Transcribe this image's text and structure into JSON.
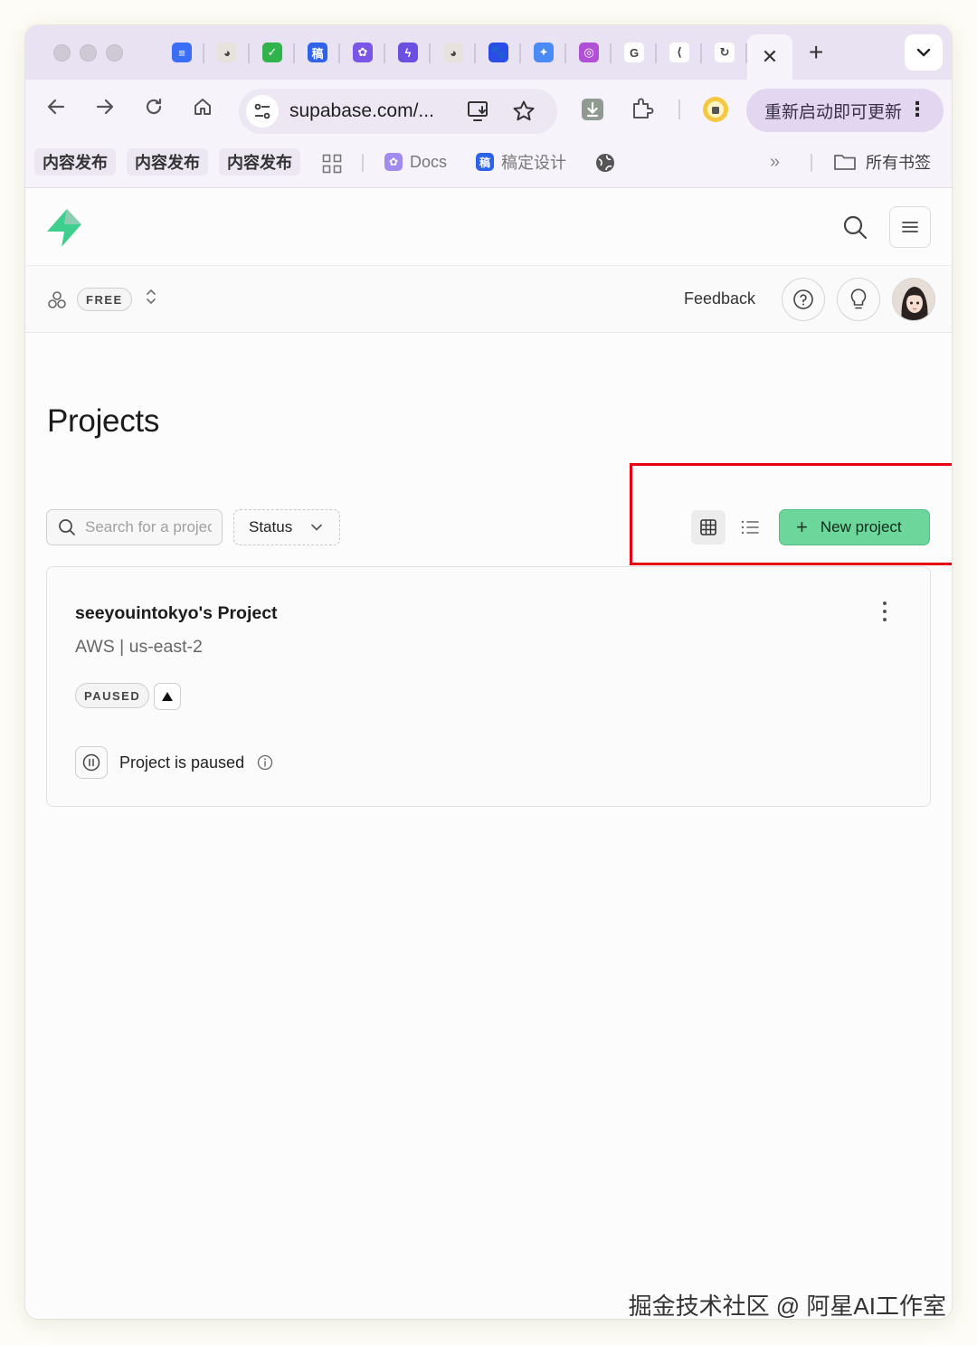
{
  "browser": {
    "tab_favicons": [
      {
        "name": "docs-favicon",
        "color": "#3b6ef6",
        "glyph": "≡"
      },
      {
        "name": "avatar-favicon",
        "color": "#e8e2dc",
        "glyph": "◕"
      },
      {
        "name": "check-favicon",
        "color": "#2fb34a",
        "glyph": "✓"
      },
      {
        "name": "gao-favicon",
        "color": "#2e62e8",
        "glyph": "稿"
      },
      {
        "name": "purple-app-favicon",
        "color": "#7a55e6",
        "glyph": "✿"
      },
      {
        "name": "bolt-app-favicon",
        "color": "#6b4fe0",
        "glyph": "ϟ"
      },
      {
        "name": "avatar-favicon-2",
        "color": "#e8e2dc",
        "glyph": "◕"
      },
      {
        "name": "baidu-favicon",
        "color": "#2a4de8",
        "glyph": "🐾"
      },
      {
        "name": "gemini-favicon",
        "color": "#4a8af4",
        "glyph": "✦"
      },
      {
        "name": "gradient-favicon",
        "color": "#b04fd8",
        "glyph": "◎"
      },
      {
        "name": "google-favicon",
        "color": "#ffffff",
        "glyph": "G"
      },
      {
        "name": "flutter-favicon",
        "color": "#ffffff",
        "glyph": "⟨"
      },
      {
        "name": "recycle-favicon",
        "color": "#ffffff",
        "glyph": "↻"
      }
    ],
    "active_tab_close": "✕",
    "new_tab": "+",
    "tab_menu": "⌄",
    "url": "supabase.com/...",
    "update_label": "重新启动即可更新"
  },
  "bookmarks": {
    "chips": [
      "内容发布",
      "内容发布",
      "内容发布"
    ],
    "docs_label": "Docs",
    "design_label": "稿定设计",
    "overflow": "»",
    "all_bookmarks": "所有书签"
  },
  "subbar": {
    "plan": "FREE",
    "feedback": "Feedback"
  },
  "main": {
    "title": "Projects",
    "search_placeholder": "Search for a project",
    "status_filter": "Status",
    "new_project": "New project"
  },
  "project": {
    "name": "seeyouintokyo's Project",
    "provider_region": "AWS | us-east-2",
    "status_badge": "PAUSED",
    "paused_text": "Project is paused"
  },
  "colors": {
    "accent": "#6dd69a",
    "highlight": "#e60012",
    "supabase_green": "#3ecf8e"
  },
  "watermark": "掘金技术社区 @ 阿星AI工作室"
}
